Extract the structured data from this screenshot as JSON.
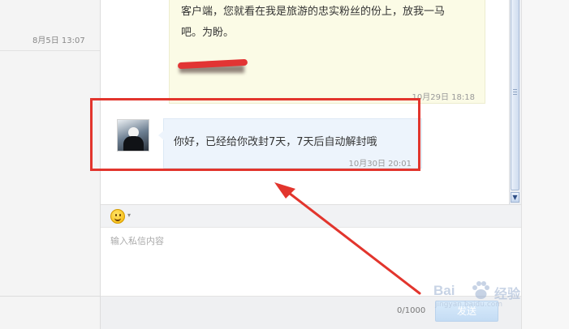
{
  "left_panel": {
    "faint_text": "一",
    "timestamp": "8月5日 13:07"
  },
  "messages": [
    {
      "type": "received",
      "text_lines": [
        "客户端，您就看在我是旅游的忠实粉丝的份上，放我一马",
        "吧。为盼。"
      ],
      "signature_redacted": true,
      "timestamp": "10月29日 18:18"
    },
    {
      "type": "sent_reply",
      "avatar": "user-avatar",
      "text": "你好，已经给你改封7天，7天后自动解封哦",
      "timestamp": "10月30日 20:01"
    }
  ],
  "composer": {
    "emoji_icon": "smiley-icon",
    "emoji_arrow": "▾",
    "placeholder": "输入私信内容",
    "char_count": "0/1000",
    "send_label": "发送"
  },
  "scrollbar": {
    "down_arrow": "▼"
  },
  "annotation": {
    "highlight_color": "#e2352d",
    "arrow_color": "#e2352d"
  },
  "watermark": {
    "brand_left": "Bai",
    "brand_right": "经验",
    "url": "jingyan.baidu.com"
  }
}
